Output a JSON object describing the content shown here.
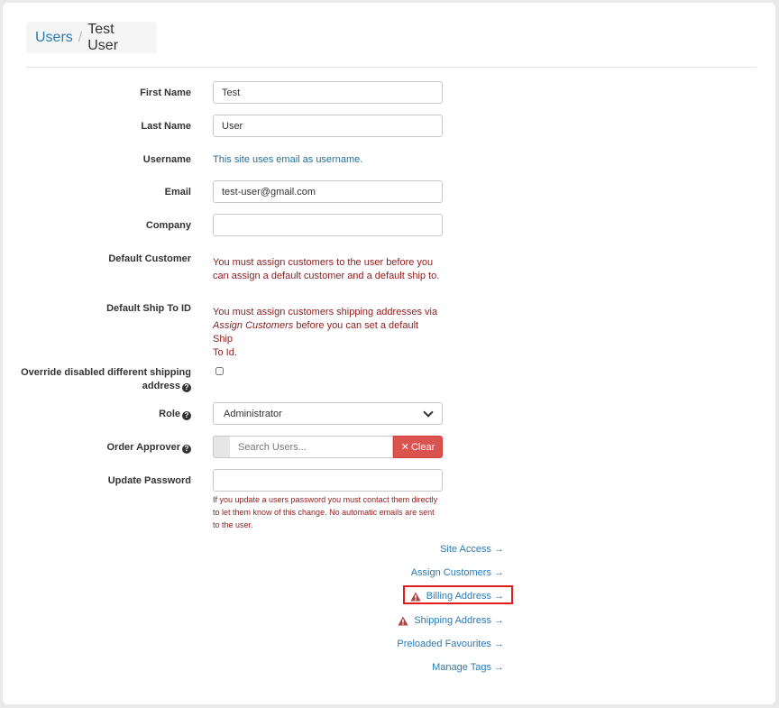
{
  "breadcrumb": {
    "parent": "Users",
    "separator": "/",
    "current": "Test User"
  },
  "form": {
    "first_name": {
      "label": "First Name",
      "value": "Test"
    },
    "last_name": {
      "label": "Last Name",
      "value": "User"
    },
    "username": {
      "label": "Username",
      "info": "This site uses email as username."
    },
    "email": {
      "label": "Email",
      "value": "test-user@gmail.com"
    },
    "company": {
      "label": "Company",
      "value": ""
    },
    "default_customer": {
      "label": "Default Customer",
      "line1": "You must assign customers to the user before you",
      "line2": "can assign a default customer and a default ship to."
    },
    "default_ship_to": {
      "label": "Default Ship To ID",
      "line1": "You must assign customers shipping addresses via",
      "line2_em": "Assign Customers",
      "line2_rest": " before you can set a default Ship",
      "line3": "To Id."
    },
    "override_shipping": {
      "label_line1": "Override disabled different shipping",
      "label_line2": "address",
      "checked": false
    },
    "role": {
      "label": "Role",
      "value": "Administrator"
    },
    "order_approver": {
      "label": "Order Approver",
      "placeholder": "Search Users...",
      "clear_label": "Clear"
    },
    "update_password": {
      "label": "Update Password",
      "value": "",
      "warning_line1": "If you update a users password you must contact them directly",
      "warning_line2": "to let them know of this change. No automatic emails are sent",
      "warning_line3": "to the user."
    }
  },
  "links": {
    "site_access": "Site Access →",
    "assign_customers": "Assign Customers →",
    "billing_address": "Billing Address →",
    "shipping_address": "Shipping Address →",
    "preloaded_favourites": "Preloaded Favourites →",
    "manage_tags": "Manage Tags →"
  },
  "colors": {
    "link": "#2a7ab6",
    "warning": "#8f1b1b",
    "danger": "#d9534f",
    "highlight": "#e11b1b"
  },
  "icons": {
    "help": "question-circle-icon",
    "warning": "warning-triangle-icon",
    "clear": "times-icon"
  }
}
